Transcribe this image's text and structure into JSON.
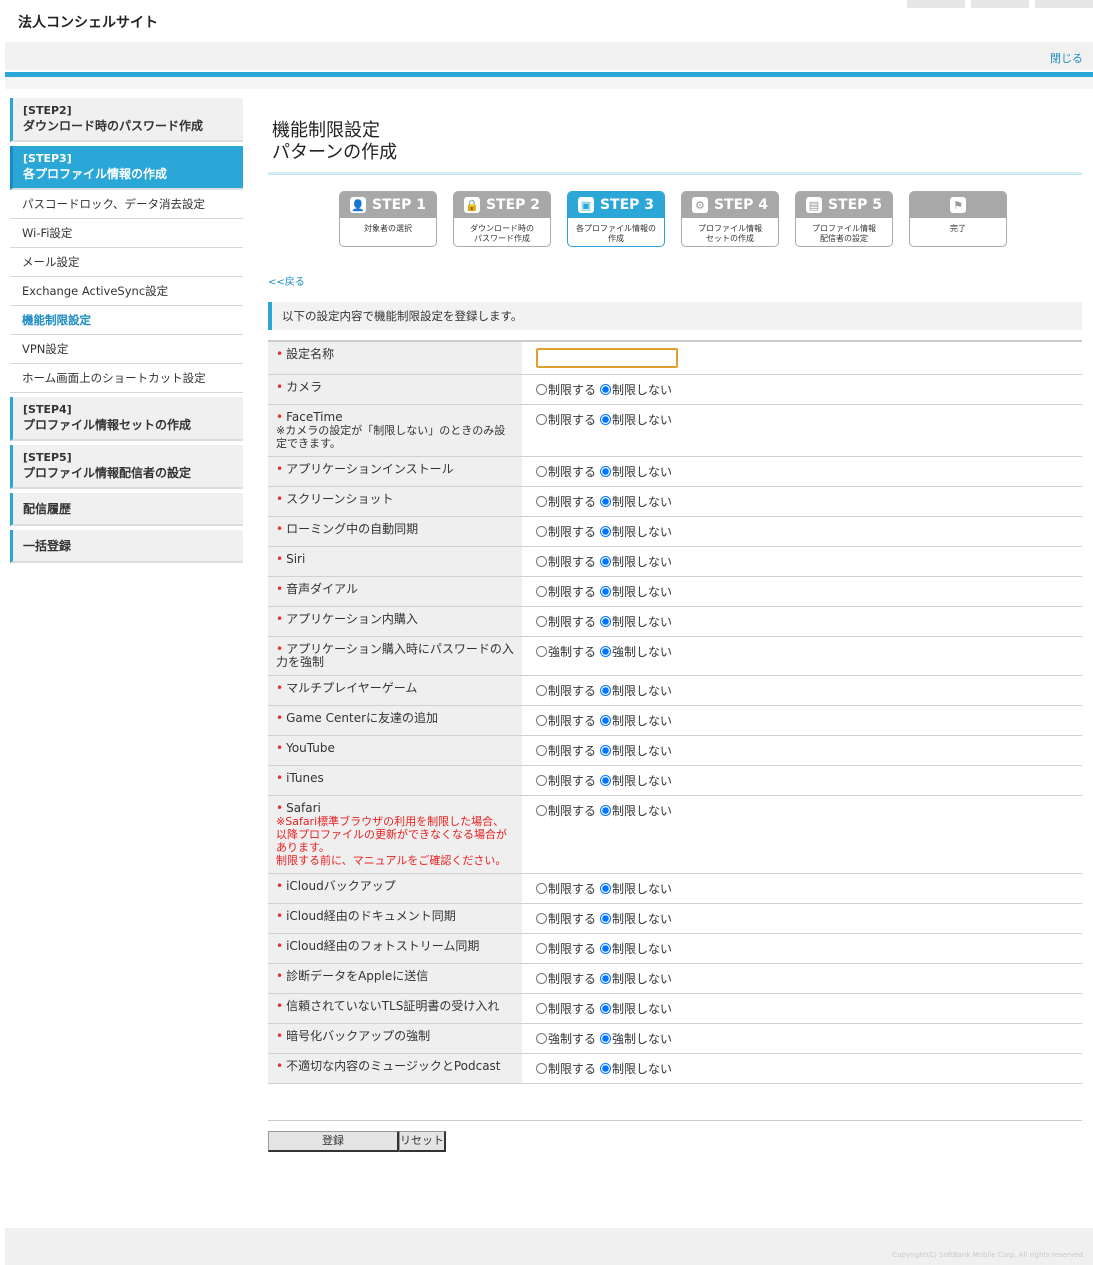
{
  "header": {
    "site_title": "法人コンシェルサイト",
    "close_label": "閉じる"
  },
  "sidebar": {
    "step2": {
      "step": "[STEP2]",
      "label": "ダウンロード時のパスワード作成"
    },
    "step3": {
      "step": "[STEP3]",
      "label": "各プロファイル情報の作成"
    },
    "items": [
      "パスコードロック、データ消去設定",
      "Wi-Fi設定",
      "メール設定",
      "Exchange ActiveSync設定",
      "機能制限設定",
      "VPN設定",
      "ホーム画面上のショートカット設定"
    ],
    "step4": {
      "step": "[STEP4]",
      "label": "プロファイル情報セットの作成"
    },
    "step5": {
      "step": "[STEP5]",
      "label": "プロファイル情報配信者の設定"
    },
    "history": "配信履歴",
    "bulk": "一括登録"
  },
  "main": {
    "title_line1": "機能制限設定",
    "title_line2": "パターンの作成",
    "steps": [
      {
        "label": "STEP 1",
        "sub": "対象者の選択",
        "icon": "person-icon"
      },
      {
        "label": "STEP 2",
        "sub": "ダウンロード時の\nパスワード作成",
        "icon": "lock-icon"
      },
      {
        "label": "STEP 3",
        "sub": "各プロファイル情報の\n作成",
        "icon": "profile-icon"
      },
      {
        "label": "STEP 4",
        "sub": "プロファイル情報\nセットの作成",
        "icon": "set-icon"
      },
      {
        "label": "STEP 5",
        "sub": "プロファイル情報\n配信者の設定",
        "icon": "group-icon"
      },
      {
        "label": "",
        "sub": "完了",
        "icon": "flag-icon"
      }
    ],
    "back_link": "<<戻る",
    "notice": "以下の設定内容で機能制限設定を登録します。",
    "name_label": "設定名称",
    "name_value": "",
    "restrict": "制限する",
    "no_restrict": "制限しない",
    "force": "強制する",
    "no_force": "強制しない",
    "rows": [
      {
        "label": "カメラ"
      },
      {
        "label": "FaceTime",
        "note": "※カメラの設定が「制限しない」のときのみ設定できます。"
      },
      {
        "label": "アプリケーションインストール"
      },
      {
        "label": "スクリーンショット"
      },
      {
        "label": "ローミング中の自動同期"
      },
      {
        "label": "Siri"
      },
      {
        "label": "音声ダイアル"
      },
      {
        "label": "アプリケーション内購入"
      },
      {
        "label": "アプリケーション購入時にパスワードの入力を強制",
        "force": true
      },
      {
        "label": "マルチプレイヤーゲーム"
      },
      {
        "label": "Game Centerに友達の追加"
      },
      {
        "label": "YouTube"
      },
      {
        "label": "iTunes"
      },
      {
        "label": "Safari",
        "warn": "※Safari標準ブラウザの利用を制限した場合、以降プロファイルの更新ができなくなる場合があります。\n制限する前に、マニュアルをご確認ください。"
      },
      {
        "label": "iCloudバックアップ"
      },
      {
        "label": "iCloud経由のドキュメント同期"
      },
      {
        "label": "iCloud経由のフォトストリーム同期"
      },
      {
        "label": "診断データをAppleに送信"
      },
      {
        "label": "信頼されていないTLS証明書の受け入れ"
      },
      {
        "label": "暗号化バックアップの強制",
        "force": true
      },
      {
        "label": "不適切な内容のミュージックとPodcast"
      }
    ],
    "submit_label": "登録",
    "reset_label": "リセット"
  },
  "footer": {
    "copyright": "Copyright(C) SoftBank Mobile Corp. All rights reserved."
  }
}
